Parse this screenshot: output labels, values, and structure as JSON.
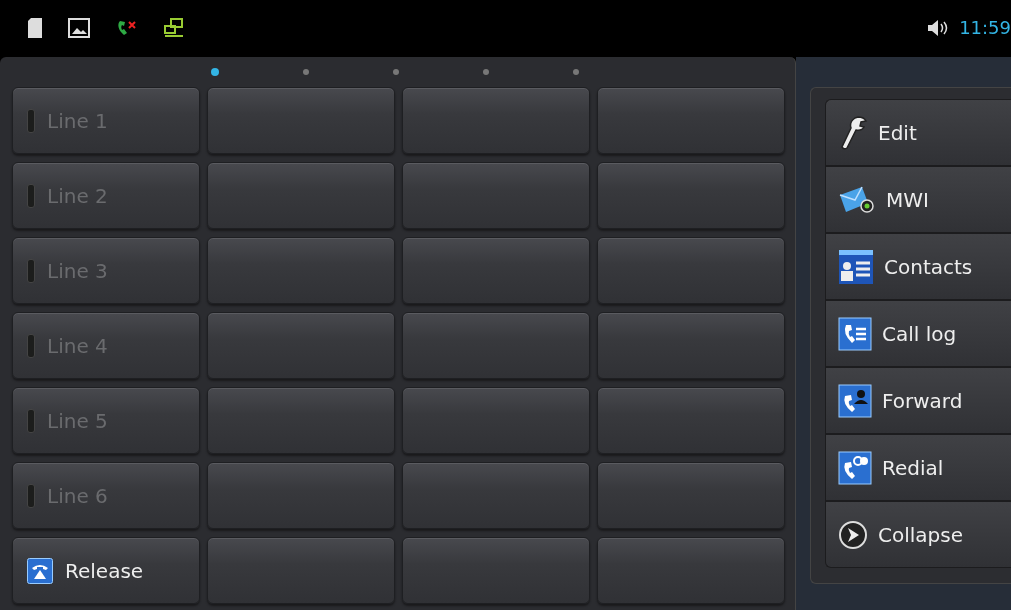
{
  "status_bar": {
    "time": "11:59"
  },
  "pages": [
    {
      "selected": true
    },
    {
      "selected": false
    },
    {
      "selected": false
    },
    {
      "selected": false
    },
    {
      "selected": false
    }
  ],
  "keys": [
    [
      {
        "kind": "line",
        "label": "Line 1"
      },
      {
        "kind": "blank"
      },
      {
        "kind": "blank"
      },
      {
        "kind": "blank"
      }
    ],
    [
      {
        "kind": "line",
        "label": "Line 2"
      },
      {
        "kind": "blank"
      },
      {
        "kind": "blank"
      },
      {
        "kind": "blank"
      }
    ],
    [
      {
        "kind": "line",
        "label": "Line 3"
      },
      {
        "kind": "blank"
      },
      {
        "kind": "blank"
      },
      {
        "kind": "blank"
      }
    ],
    [
      {
        "kind": "line",
        "label": "Line 4"
      },
      {
        "kind": "blank"
      },
      {
        "kind": "blank"
      },
      {
        "kind": "blank"
      }
    ],
    [
      {
        "kind": "line",
        "label": "Line 5"
      },
      {
        "kind": "blank"
      },
      {
        "kind": "blank"
      },
      {
        "kind": "blank"
      }
    ],
    [
      {
        "kind": "line",
        "label": "Line 6"
      },
      {
        "kind": "blank"
      },
      {
        "kind": "blank"
      },
      {
        "kind": "blank"
      }
    ],
    [
      {
        "kind": "release",
        "label": "Release"
      },
      {
        "kind": "blank"
      },
      {
        "kind": "blank"
      },
      {
        "kind": "blank"
      }
    ]
  ],
  "menu": [
    {
      "kind": "edit",
      "label": "Edit"
    },
    {
      "kind": "mwi",
      "label": "MWI"
    },
    {
      "kind": "contacts",
      "label": "Contacts"
    },
    {
      "kind": "calllog",
      "label": "Call log"
    },
    {
      "kind": "forward",
      "label": "Forward"
    },
    {
      "kind": "redial",
      "label": "Redial"
    },
    {
      "kind": "collapse",
      "label": "Collapse"
    }
  ]
}
